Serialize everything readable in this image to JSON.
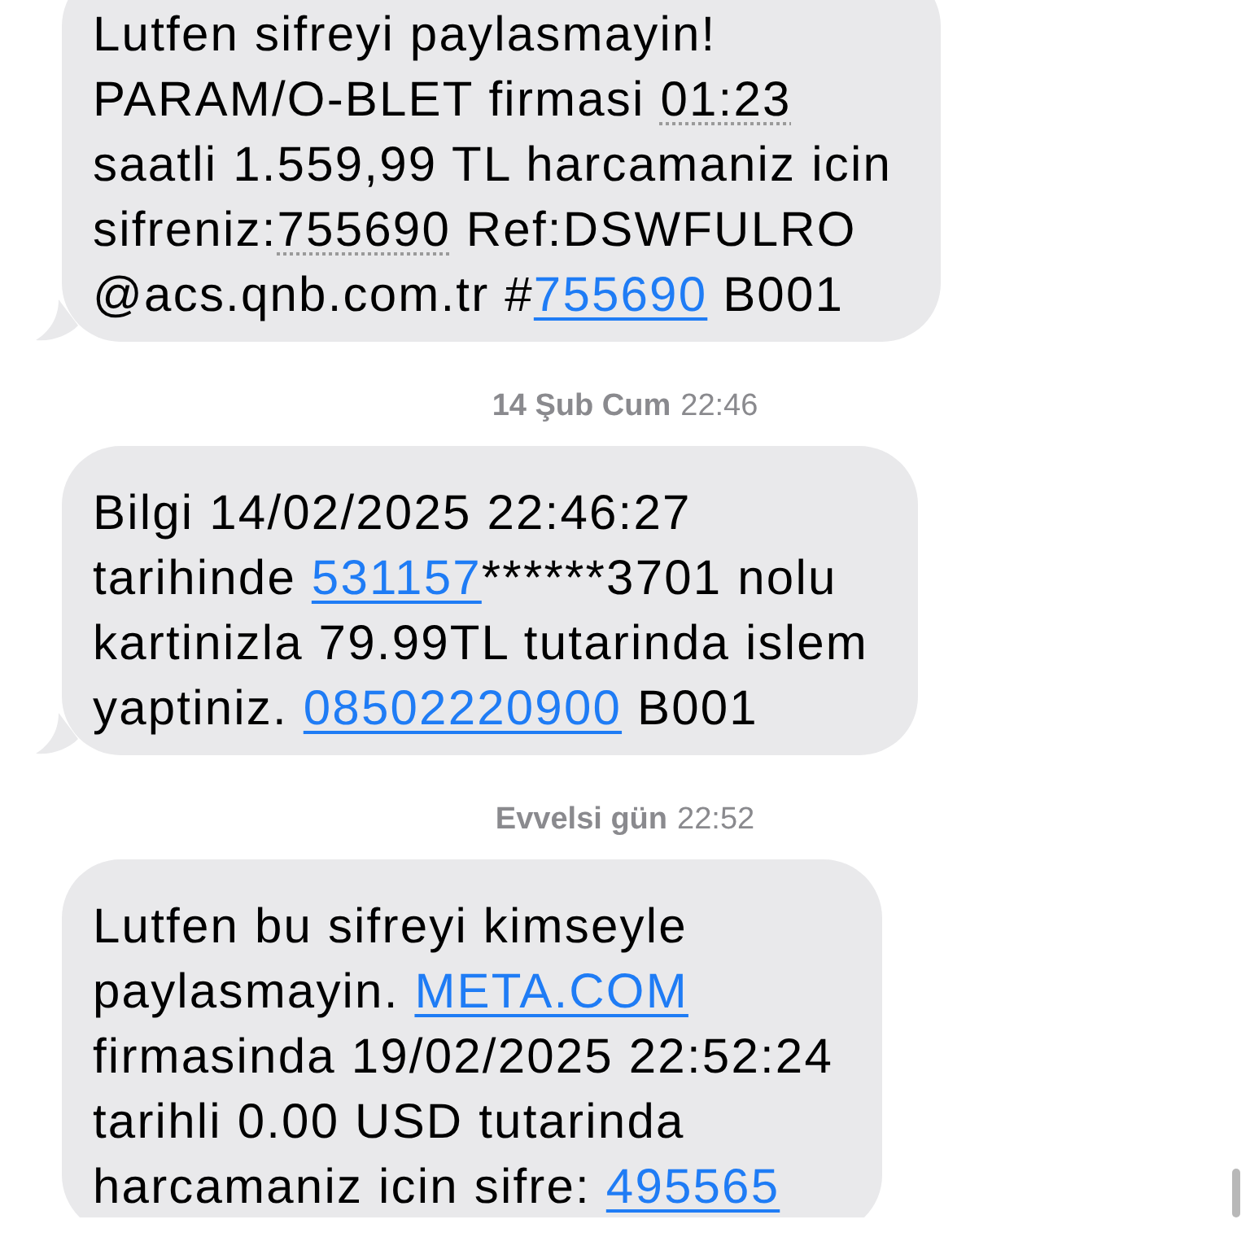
{
  "messages": [
    {
      "kind": "bubble",
      "tail": true,
      "lines": [
        [
          {
            "kind": "text",
            "text": "Lutfen sifreyi paylasmayin!"
          }
        ],
        [
          {
            "kind": "text",
            "text": "PARAM/O-BLET firmasi "
          },
          {
            "kind": "data",
            "text": "01:23"
          }
        ],
        [
          {
            "kind": "text",
            "text": "saatli 1.559,99 TL harcamaniz icin"
          }
        ],
        [
          {
            "kind": "text",
            "text": "sifreniz:"
          },
          {
            "kind": "data",
            "text": "755690"
          },
          {
            "kind": "text",
            "text": " Ref:DSWFULRO"
          }
        ],
        [
          {
            "kind": "text",
            "text": "@acs.qnb.com.tr #"
          },
          {
            "kind": "link",
            "text": "755690"
          },
          {
            "kind": "text",
            "text": " B001"
          }
        ]
      ]
    },
    {
      "kind": "timestamp",
      "date": "14 Şub Cum",
      "time": "22:46"
    },
    {
      "kind": "bubble",
      "tail": true,
      "lines": [
        [
          {
            "kind": "text",
            "text": "Bilgi 14/02/2025 22:46:27"
          }
        ],
        [
          {
            "kind": "text",
            "text": "tarihinde "
          },
          {
            "kind": "link",
            "text": "531157"
          },
          {
            "kind": "text",
            "text": "******3701 nolu"
          }
        ],
        [
          {
            "kind": "text",
            "text": "kartinizla 79.99TL tutarinda islem"
          }
        ],
        [
          {
            "kind": "text",
            "text": "yaptiniz. "
          },
          {
            "kind": "link",
            "text": "08502220900"
          },
          {
            "kind": "text",
            "text": " B001"
          }
        ]
      ]
    },
    {
      "kind": "timestamp",
      "date": "Evvelsi gün",
      "time": "22:52"
    },
    {
      "kind": "bubble",
      "tail": false,
      "lines": [
        [
          {
            "kind": "text",
            "text": "Lutfen bu sifreyi kimseyle"
          }
        ],
        [
          {
            "kind": "text",
            "text": "paylasmayin. "
          },
          {
            "kind": "link",
            "text": "META.COM"
          }
        ],
        [
          {
            "kind": "text",
            "text": "firmasinda 19/02/2025 22:52:24"
          }
        ],
        [
          {
            "kind": "text",
            "text": "tarihli 0.00 USD tutarinda"
          }
        ],
        [
          {
            "kind": "text",
            "text": "harcamaniz icin sifre: "
          },
          {
            "kind": "link",
            "text": "495565"
          }
        ]
      ]
    }
  ]
}
